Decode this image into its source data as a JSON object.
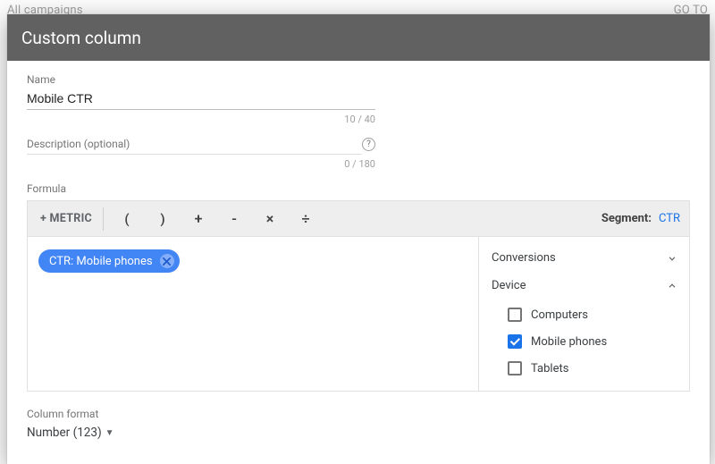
{
  "backdrop": {
    "breadcrumb": "All campaigns",
    "goto": "GO TO"
  },
  "modal": {
    "title": "Custom column"
  },
  "name": {
    "label": "Name",
    "value": "Mobile CTR",
    "counter": "10 / 40"
  },
  "description": {
    "label": "Description (optional)",
    "value": "",
    "counter": "0 / 180"
  },
  "formula": {
    "label": "Formula",
    "metric_btn": "+ METRIC",
    "ops": {
      "lparen": "(",
      "rparen": ")",
      "plus": "+",
      "minus": "-",
      "times": "×",
      "divide": "÷"
    },
    "segment_label": "Segment:",
    "segment_value": "CTR",
    "chip": "CTR: Mobile phones"
  },
  "segments": {
    "conversions": {
      "label": "Conversions",
      "expanded": false
    },
    "device": {
      "label": "Device",
      "expanded": true,
      "options": [
        {
          "label": "Computers",
          "checked": false
        },
        {
          "label": "Mobile phones",
          "checked": true
        },
        {
          "label": "Tablets",
          "checked": false
        }
      ]
    }
  },
  "column_format": {
    "label": "Column format",
    "value": "Number (123)"
  }
}
